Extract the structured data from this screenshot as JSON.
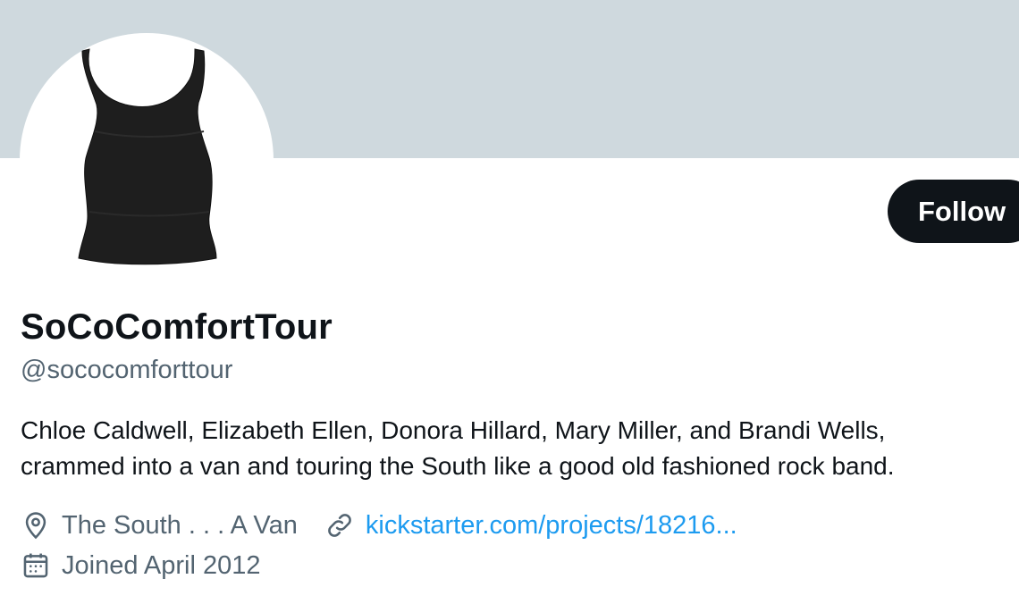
{
  "profile": {
    "display_name": "SoCoComfortTour",
    "handle": "@sococomforttour",
    "bio_lines": [
      "Chloe Caldwell, Elizabeth Ellen, Donora Hillard, Mary Miller, and Brandi Wells,",
      "crammed into a van and touring the South like a good old fashioned rock band."
    ],
    "location": "The South . . . A Van",
    "website": "kickstarter.com/projects/18216...",
    "joined": "Joined April 2012"
  },
  "actions": {
    "follow_label": "Follow"
  },
  "icons": {
    "location": "location-pin-icon",
    "link": "link-icon",
    "calendar": "calendar-icon"
  },
  "colors": {
    "banner": "#cfd9de",
    "follow_bg": "#0f1419",
    "secondary_text": "#536471",
    "link": "#1d9bf0"
  }
}
